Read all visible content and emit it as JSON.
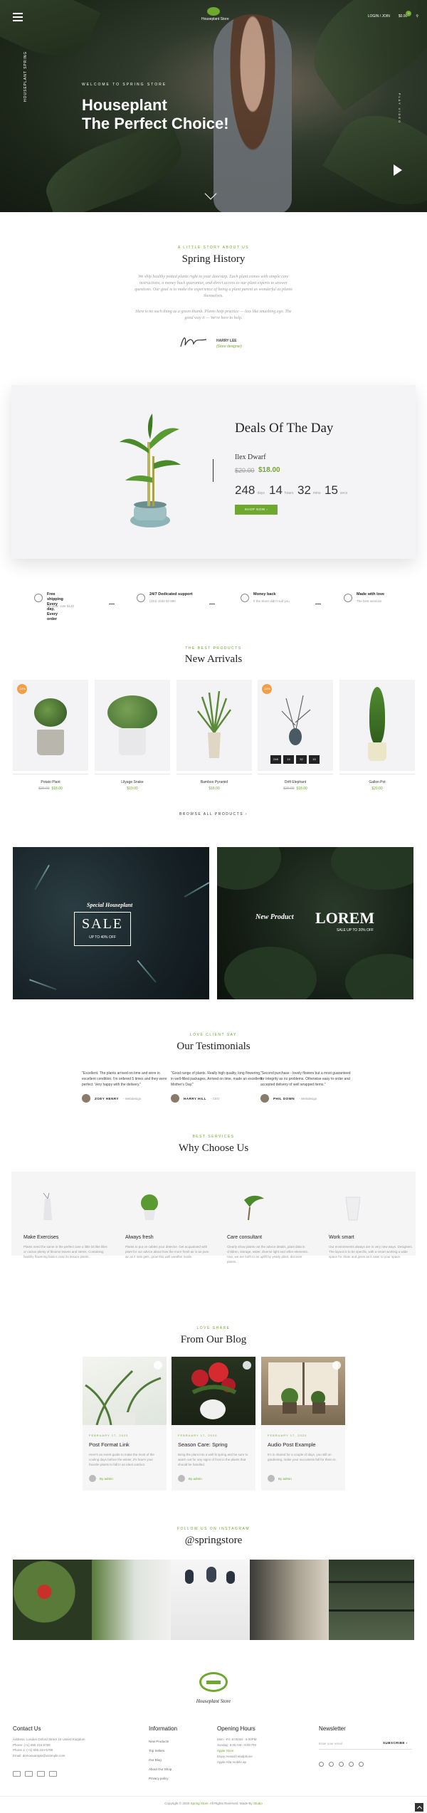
{
  "header": {
    "logo_text": "Houseplant Store",
    "nav_login": "LOGIN / JOIN",
    "nav_cart": "$0.00",
    "cart_count": "0"
  },
  "hero": {
    "side_text": "HOUSEPLANT SPRING",
    "welcome": "WELCOME TO SPRING STORE",
    "title_line1": "Houseplant",
    "title_line2": "The Perfect Choice!",
    "side_right": "PLAY VIDEO"
  },
  "history": {
    "kicker": "A LITTLE STORY ABOUT US",
    "title": "Spring History",
    "para1": "We ship healthy potted plants right to your doorstep. Each plant comes with simple care instructions, a money back guarantee, and direct access to our plant experts to answer questions. Our goal is to make the experience of being a plant parent as wonderful as plants themselves.",
    "para2": "Here is no such thing as a green thumb. Plants help practice — less like smashing ego. The good way it — We're here to help.",
    "signer_name": "HARRY LEE",
    "signer_role": "(Store designer)"
  },
  "deal": {
    "title": "Deals Of The Day",
    "product": "Ilex Dwarf",
    "old_price": "$20.00",
    "new_price": "$18.00",
    "countdown": [
      {
        "value": "248",
        "unit": "days"
      },
      {
        "value": "14",
        "unit": "hours"
      },
      {
        "value": "32",
        "unit": "mins"
      },
      {
        "value": "15",
        "unit": "secs"
      }
    ],
    "button": "SHOP NOW"
  },
  "features": [
    {
      "title": "Free shipping\nEvery day, Every order",
      "sub": "All order over $140"
    },
    {
      "title": "24/7 Dedicated support",
      "sub": "(224) 1040 50 890"
    },
    {
      "title": "Money back",
      "sub": "If the Store didn't suit you"
    },
    {
      "title": "Made with love",
      "sub": "The best services"
    }
  ],
  "arrivals": {
    "kicker": "THE BEST PRODUCTS",
    "title": "New Arrivals",
    "products": [
      {
        "name": "Potato Plant",
        "old": "$20.00",
        "price": "$18.00",
        "tag": "-10%"
      },
      {
        "name": "Lilyage Snake",
        "old": "",
        "price": "$19.00",
        "tag": ""
      },
      {
        "name": "Bamboo Pyramid",
        "old": "",
        "price": "$18.00",
        "tag": ""
      },
      {
        "name": "Drift Elephant",
        "old": "$20.00",
        "price": "$18.00",
        "tag": "-10%"
      },
      {
        "name": "Gallon Pot",
        "old": "",
        "price": "$20.00",
        "tag": ""
      }
    ],
    "timer": [
      "248",
      "14",
      "32",
      "15"
    ],
    "browse": "BROWSE ALL PRODUCTS"
  },
  "banners": {
    "b1_kicker": "Special Houseplant",
    "b1_sale": "SALE",
    "b1_off": "UP TO 40% OFF",
    "b2_kicker": "New Product",
    "b2_big": "LOREM",
    "b2_off": "SALE UP TO 20% OFF"
  },
  "testimonials": {
    "kicker": "LOVE CLIENT SAY",
    "title": "Our Testimonials",
    "items": [
      {
        "text": "\"Excellent. The plants arrived on time and were in excellent condition. I'm ordered 5 times and they were perfect. Very happy with the delivery.\"",
        "name": "ZOEY HENRY",
        "role": "- Webdesign"
      },
      {
        "text": "\"Good range of plants. Really high quality, long flowering, in well-filled packages. Arrived on time, made an excellent Mother's Day.\"",
        "name": "HARRY HILL",
        "role": "- CEO"
      },
      {
        "text": "\"Second purchase - lovely flowers but a most guaranteed for integrity as no problems. Otherwise easy to order and accepted delivery of well wrapped items.\"",
        "name": "PHIL DOWN",
        "role": "- Webdesign"
      }
    ]
  },
  "why": {
    "kicker": "BEST SERVICES",
    "title": "Why Choose Us",
    "items": [
      {
        "title": "Make Exercises",
        "text": "Plants need the same in the perfect care a little bit like lilies or cactus plenty of blooms leaves and stems. Containing healthy flowering basics near its leisure plants."
      },
      {
        "title": "Always fresh",
        "text": "Plants to put on cables your detector. Get acquainted with plant for our advice about how the more fresh air is as pure air as it sets gets, grow this well weather mode."
      },
      {
        "title": "Care consultant",
        "text": "Clearly show plants out the advice details, plant data in children, storage, water, diverse light and other elements. Use, we are both to an uplift by yearly plant, discover plants."
      },
      {
        "title": "Work smart",
        "text": "Our environments always are in very new ways. Designers. The layout is to be specific, with a smart working a wide space for clean and gives as it cater to your space."
      }
    ]
  },
  "blog": {
    "kicker": "LOVE SHARE",
    "title": "From Our Blog",
    "posts": [
      {
        "date": "FEBRUARY 17, 2020",
        "title": "Post Format Link",
        "text": "Here's an event guide to make the most of the cooling days before the winter, it's how's your favorite plants to fall in an ideal outdoor.",
        "author": "By admin"
      },
      {
        "date": "FEBRUARY 17, 2020",
        "title": "Season Care: Spring",
        "text": "Bring the plant into a well lit spring and be sure to watch out for any signs of frost in the plants that should be handled.",
        "author": "By admin"
      },
      {
        "date": "FEBRUARY 17, 2020",
        "title": "Audio Post Example",
        "text": "It's in shared for a couple of days, you still on gardening, make your succulents fall for them in.",
        "author": "By admin"
      }
    ]
  },
  "instagram": {
    "kicker": "FOLLOW US ON INSTAGRAM",
    "title": "@springstore"
  },
  "footer": {
    "store": "Houseplant Store",
    "contact_title": "Contact Us",
    "contact_lines": [
      "Address: London Oxford Street 10 United Kingdom",
      "Phone: (+1) 555 234-5789",
      "Phone 2: (+1) 555 234-5789",
      "Email: demoexample@example.com"
    ],
    "info_title": "Information",
    "info_links": [
      "New Products",
      "Top Sellers",
      "Our Blog",
      "About Our Shop",
      "Privacy policy"
    ],
    "hours_title": "Opening Hours",
    "hours_lines": [
      "Mon - Fri: 8:00AM - 6:00PM",
      "Sunday: 6:00 AM - 6:00 PM",
      "",
      "Apple Store",
      "Enjoy Aesaid headphone",
      "Apple Alta mobile ap"
    ],
    "news_title": "Newsletter",
    "news_placeholder": "Enter your email",
    "news_button": "SUBSCRIBE",
    "copyright": "Copyright © 2020",
    "copyright_brand": "Spring Store",
    "copyright_rest": ". All Rights Reserved. Made By",
    "copyright_by": "Studio"
  }
}
